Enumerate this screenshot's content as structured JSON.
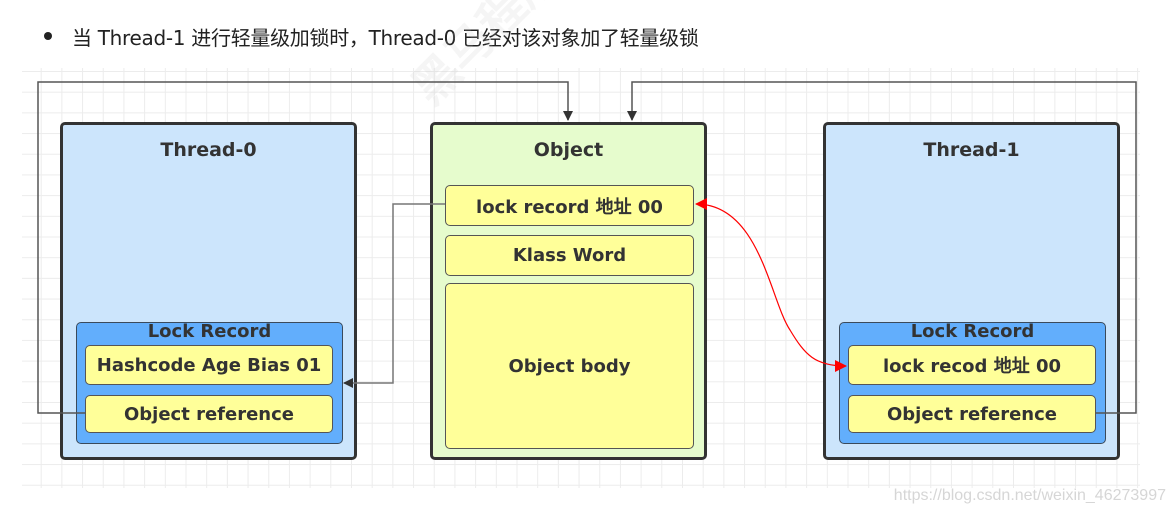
{
  "heading": {
    "text": "当 Thread-1 进行轻量级加锁时，Thread-0 已经对该对象加了轻量级锁"
  },
  "diagram": {
    "thread0": {
      "title": "Thread-0",
      "lock_record": {
        "title": "Lock Record",
        "cells": [
          "Hashcode Age Bias 01",
          "Object reference"
        ]
      }
    },
    "object": {
      "title": "Object",
      "cells": [
        "lock  record 地址 00",
        "Klass Word",
        "Object body"
      ]
    },
    "thread1": {
      "title": "Thread-1",
      "lock_record": {
        "title": "Lock Record",
        "cells": [
          "lock recod 地址 00",
          "Object reference"
        ]
      }
    },
    "colors": {
      "thread_fill": "#cce5fc",
      "object_fill": "#e6fccd",
      "lock_record_fill": "#62aefc",
      "cell_fill": "#ffff99",
      "swap_arrow": "#ff0000"
    },
    "logo_watermark": "黑马程序员 www.itheima.com"
  },
  "watermark": "https://blog.csdn.net/weixin_46273997"
}
